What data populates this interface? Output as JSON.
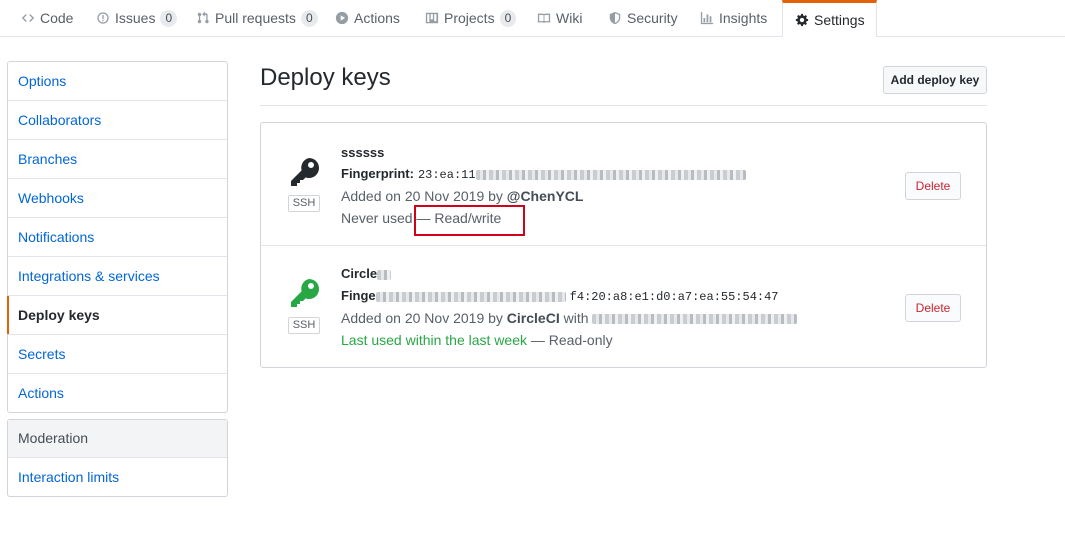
{
  "tabs": [
    {
      "label": "Code",
      "icon": "code-icon"
    },
    {
      "label": "Issues",
      "icon": "issue-icon",
      "count": "0"
    },
    {
      "label": "Pull requests",
      "icon": "pull-request-icon",
      "count": "0"
    },
    {
      "label": "Actions",
      "icon": "play-icon"
    },
    {
      "label": "Projects",
      "icon": "project-icon",
      "count": "0"
    },
    {
      "label": "Wiki",
      "icon": "book-icon"
    },
    {
      "label": "Security",
      "icon": "shield-icon"
    },
    {
      "label": "Insights",
      "icon": "graph-icon"
    },
    {
      "label": "Settings",
      "icon": "gear-icon",
      "selected": true
    }
  ],
  "sidebar": {
    "items": [
      {
        "label": "Options"
      },
      {
        "label": "Collaborators"
      },
      {
        "label": "Branches"
      },
      {
        "label": "Webhooks"
      },
      {
        "label": "Notifications"
      },
      {
        "label": "Integrations & services"
      },
      {
        "label": "Deploy keys",
        "active": true
      },
      {
        "label": "Secrets"
      },
      {
        "label": "Actions"
      }
    ],
    "moderation_heading": "Moderation",
    "moderation_items": [
      {
        "label": "Interaction limits"
      }
    ]
  },
  "main": {
    "title": "Deploy keys",
    "add_button": "Add deploy key",
    "keys": [
      {
        "name": "ssssss",
        "badge": "SSH",
        "fingerprint_label": "Fingerprint:",
        "fingerprint_visible": "23:ea:11",
        "added": "Added on 20 Nov 2019 by",
        "added_by": "@ChenYCL",
        "usage": "Never used",
        "access": "— Read/write",
        "icon_color": "#24292e",
        "delete_label": "Delete"
      },
      {
        "name": "Circle",
        "badge": "SSH",
        "fingerprint_label": "Finge",
        "fingerprint_visible": "f4:20:a8:e1:d0:a7:ea:55:54:47",
        "added": "Added on 20 Nov 2019 by",
        "added_by": "CircleCI",
        "added_suffix": "with",
        "usage": "Last used within the last week",
        "access": "— Read-only",
        "icon_color": "#28a745",
        "delete_label": "Delete"
      }
    ]
  },
  "colors": {
    "accent": "#e36209",
    "link": "#0366d6",
    "danger": "#cb2431",
    "highlight": "#d0021b"
  }
}
